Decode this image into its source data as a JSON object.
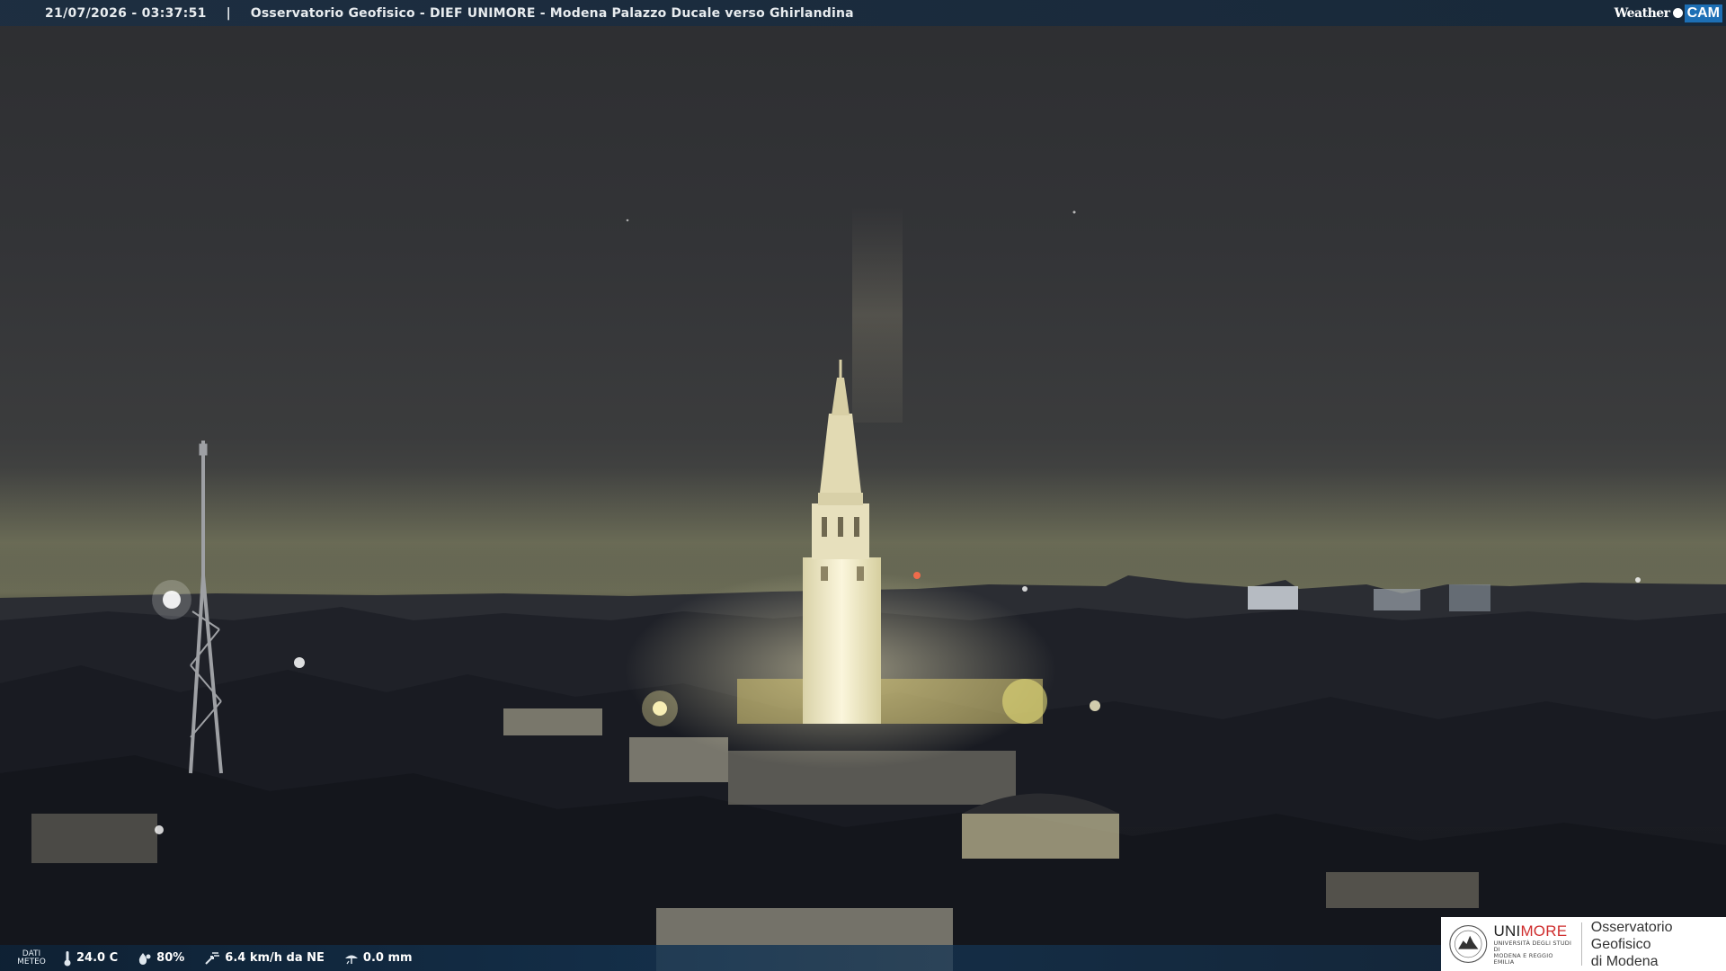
{
  "header": {
    "timestamp": "21/07/2026 - 03:37:51",
    "separator": "|",
    "title": "Osservatorio Geofisico - DIEF UNIMORE - Modena Palazzo Ducale verso Ghirlandina"
  },
  "brand": {
    "weather": "Weather",
    "cam": "CAM"
  },
  "weather": {
    "label_line1": "DATI",
    "label_line2": "METEO",
    "temperature": "24.0 C",
    "humidity": "80%",
    "wind": "6.4 km/h da NE",
    "rain": "0.0 mm"
  },
  "logo": {
    "uni_prefix": "UNI",
    "uni_suffix": "MORE",
    "uni_sub1": "UNIVERSITÀ DEGLI STUDI DI",
    "uni_sub2": "MODENA E REGGIO EMILIA",
    "obs_line1": "Osservatorio Geofisico",
    "obs_line2": "di Modena"
  },
  "colors": {
    "bar": "#1c2e42",
    "cam_blue": "#1d6fb5",
    "unimore_red": "#cf2e2e",
    "tower_light": "#f4eccd"
  }
}
